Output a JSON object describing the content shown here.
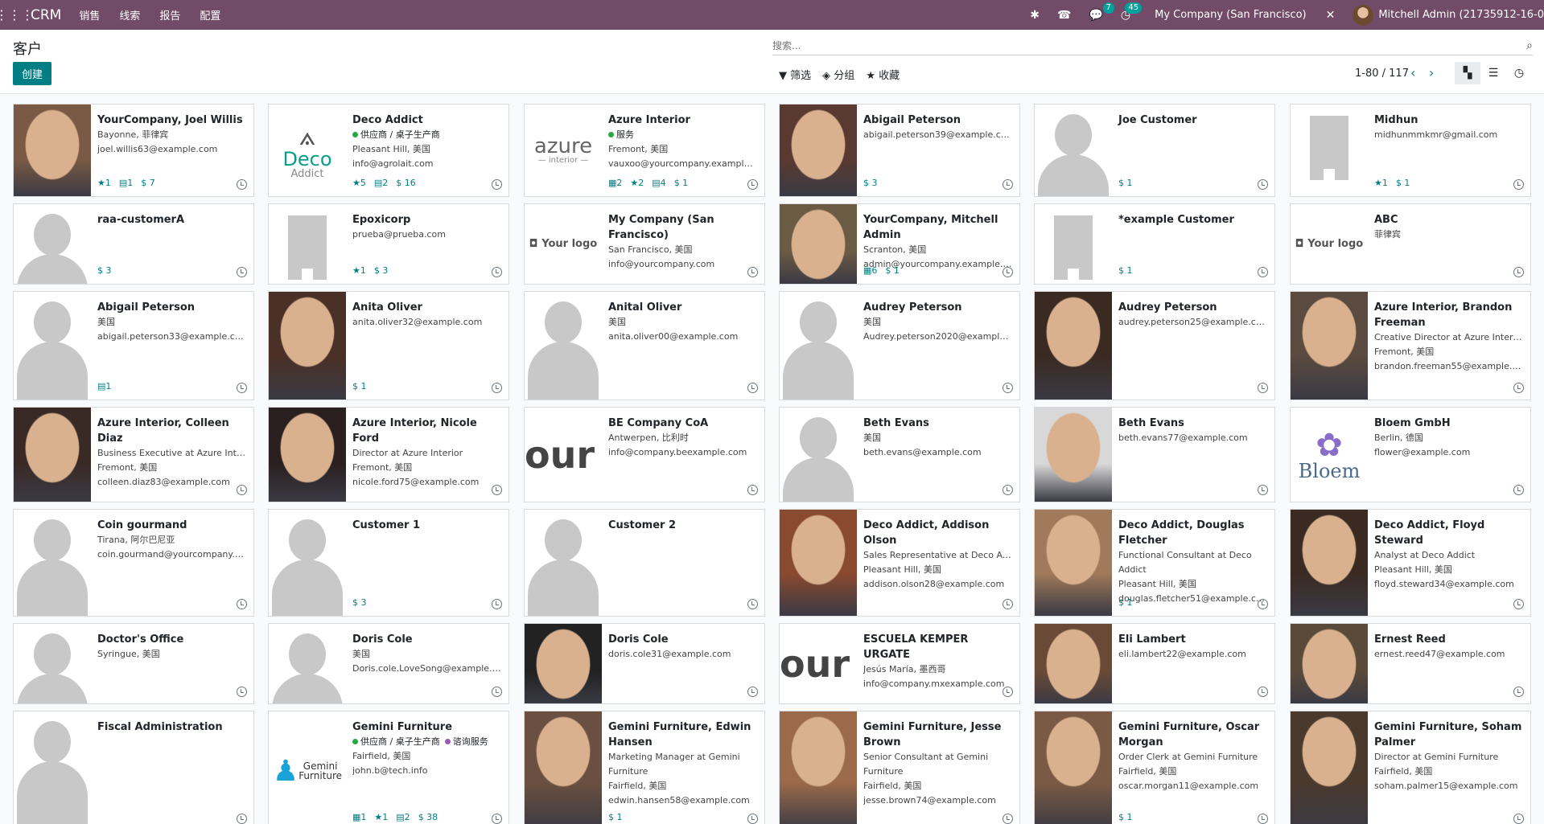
{
  "navbar": {
    "brand": "CRM",
    "menus": [
      "销售",
      "线索",
      "报告",
      "配置"
    ],
    "messages_count": "7",
    "activities_count": "45",
    "company": "My Company (San Francisco)",
    "user": "Mitchell Admin (21735912-16-0"
  },
  "control": {
    "title": "客户",
    "create": "创建",
    "search_placeholder": "搜索...",
    "filter": "筛选",
    "group": "分组",
    "favorites": "收藏",
    "pager": "1-80 / 117"
  },
  "colors": {
    "primary": "#714B67",
    "accent": "#017E84",
    "green_dot": "#28a745",
    "purple_dot": "#9b59b6"
  },
  "cards": [
    {
      "name": "YourCompany, Joel Willis",
      "lines": [
        "Bayonne, 菲律宾",
        "joel.willis63@example.com"
      ],
      "stats": [
        "★1",
        "▤1",
        "$ 7"
      ],
      "img": "photo",
      "tone": "#7a5a44"
    },
    {
      "name": "Deco Addict",
      "tags": [
        {
          "dot": "#28a745",
          "text": "供应商 / 桌子生产商"
        }
      ],
      "lines": [
        "Pleasant Hill, 美国",
        "info@agrolait.com"
      ],
      "stats": [
        "★5",
        "▤2",
        "$ 16"
      ],
      "img": "deco"
    },
    {
      "name": "Azure Interior",
      "tags": [
        {
          "dot": "#28a745",
          "text": "服务"
        }
      ],
      "lines": [
        "Fremont, 美国",
        "vauxoo@yourcompany.example.com"
      ],
      "stats": [
        "▦2",
        "★2",
        "▤4",
        "$ 1"
      ],
      "img": "azure"
    },
    {
      "name": "Abigail Peterson",
      "lines": [
        "abigail.peterson39@example.com"
      ],
      "stats": [
        "$ 3"
      ],
      "img": "photo",
      "tone": "#5a3a30"
    },
    {
      "name": "Joe Customer",
      "lines": [],
      "stats": [
        "$ 1"
      ],
      "img": "person"
    },
    {
      "name": "Midhun",
      "lines": [
        "midhunmmkmr@gmail.com"
      ],
      "stats": [
        "★1",
        "$ 1"
      ],
      "img": "building"
    },
    {
      "name": "raa-customerA",
      "lines": [],
      "stats": [
        "$ 3"
      ],
      "img": "person"
    },
    {
      "name": "Epoxicorp",
      "lines": [
        "prueba@prueba.com"
      ],
      "stats": [
        "★1",
        "$ 3"
      ],
      "img": "building"
    },
    {
      "name": "My Company (San Francisco)",
      "lines": [
        "San Francisco, 美国",
        "info@yourcompany.com"
      ],
      "stats": [],
      "img": "yourlogo"
    },
    {
      "name": "YourCompany, Mitchell Admin",
      "lines": [
        "Scranton, 美国",
        "admin@yourcompany.example.com"
      ],
      "stats": [
        "▦6",
        "$ 1"
      ],
      "img": "photo",
      "tone": "#6b5a44"
    },
    {
      "name": "*example Customer",
      "lines": [],
      "stats": [
        "$ 1"
      ],
      "img": "building"
    },
    {
      "name": "ABC",
      "lines": [
        "菲律宾"
      ],
      "stats": [],
      "img": "yourlogo"
    },
    {
      "name": "Abigail Peterson",
      "lines": [
        "美国",
        "abigail.peterson33@example.com"
      ],
      "stats": [
        "▤1"
      ],
      "img": "person"
    },
    {
      "name": "Anita Oliver",
      "lines": [
        "anita.oliver32@example.com"
      ],
      "stats": [
        "$ 1"
      ],
      "img": "photo",
      "tone": "#4a3026"
    },
    {
      "name": "Anital Oliver",
      "lines": [
        "美国",
        "anita.oliver00@example.com"
      ],
      "stats": [],
      "img": "person"
    },
    {
      "name": "Audrey Peterson",
      "lines": [
        "美国",
        "Audrey.peterson2020@example.c..."
      ],
      "stats": [],
      "img": "person"
    },
    {
      "name": "Audrey Peterson",
      "lines": [
        "audrey.peterson25@example.com"
      ],
      "stats": [],
      "img": "photo",
      "tone": "#3a2a22"
    },
    {
      "name": "Azure Interior, Brandon Freeman",
      "lines": [
        "Creative Director at Azure Interior",
        "Fremont, 美国",
        "brandon.freeman55@example.com"
      ],
      "stats": [],
      "img": "photo",
      "tone": "#5a4a40"
    },
    {
      "name": "Azure Interior, Colleen Diaz",
      "lines": [
        "Business Executive at Azure Interior",
        "Fremont, 美国",
        "colleen.diaz83@example.com"
      ],
      "stats": [],
      "img": "photo",
      "tone": "#3a2a26"
    },
    {
      "name": "Azure Interior, Nicole Ford",
      "lines": [
        "Director at Azure Interior",
        "Fremont, 美国",
        "nicole.ford75@example.com"
      ],
      "stats": [],
      "img": "photo",
      "tone": "#2a2020"
    },
    {
      "name": "BE Company CoA",
      "lines": [
        "Antwerpen, 比利时",
        "info@company.beexample.com"
      ],
      "stats": [],
      "img": "our"
    },
    {
      "name": "Beth Evans",
      "lines": [
        "美国",
        "beth.evans@example.com"
      ],
      "stats": [],
      "img": "person"
    },
    {
      "name": "Beth Evans",
      "lines": [
        "beth.evans77@example.com"
      ],
      "stats": [],
      "img": "photo",
      "tone": "#d8d8d8"
    },
    {
      "name": "Bloem GmbH",
      "lines": [
        "Berlin, 德国",
        "flower@example.com"
      ],
      "stats": [],
      "img": "bloem"
    },
    {
      "name": "Coin gourmand",
      "lines": [
        "Tirana, 阿尔巴尼亚",
        "coin.gourmand@yourcompany.exa..."
      ],
      "stats": [],
      "img": "person"
    },
    {
      "name": "Customer 1",
      "lines": [],
      "stats": [
        "$ 3"
      ],
      "img": "person"
    },
    {
      "name": "Customer 2",
      "lines": [],
      "stats": [],
      "img": "person"
    },
    {
      "name": "Deco Addict, Addison Olson",
      "lines": [
        "Sales Representative at Deco Addict",
        "Pleasant Hill, 美国",
        "addison.olson28@example.com"
      ],
      "stats": [],
      "img": "photo",
      "tone": "#8a4a30"
    },
    {
      "name": "Deco Addict, Douglas Fletcher",
      "lines": [
        "Functional Consultant at Deco",
        "Addict",
        "Pleasant Hill, 美国",
        "douglas.fletcher51@example.com"
      ],
      "stats": [
        "$ 1"
      ],
      "img": "photo",
      "tone": "#a07a5a"
    },
    {
      "name": "Deco Addict, Floyd Steward",
      "lines": [
        "Analyst at Deco Addict",
        "Pleasant Hill, 美国",
        "floyd.steward34@example.com"
      ],
      "stats": [],
      "img": "photo",
      "tone": "#3a2a22"
    },
    {
      "name": "Doctor's Office",
      "lines": [
        "Syringue, 美国"
      ],
      "stats": [],
      "img": "person"
    },
    {
      "name": "Doris Cole",
      "lines": [
        "美国",
        "Doris.cole.LoveSong@example.com"
      ],
      "stats": [],
      "img": "person"
    },
    {
      "name": "Doris Cole",
      "lines": [
        "doris.cole31@example.com"
      ],
      "stats": [],
      "img": "photo",
      "tone": "#222222"
    },
    {
      "name": "ESCUELA KEMPER URGATE",
      "lines": [
        "Jesús María, 墨西哥",
        "info@company.mxexample.com"
      ],
      "stats": [],
      "img": "our"
    },
    {
      "name": "Eli Lambert",
      "lines": [
        "eli.lambert22@example.com"
      ],
      "stats": [],
      "img": "photo",
      "tone": "#6a4a36"
    },
    {
      "name": "Ernest Reed",
      "lines": [
        "ernest.reed47@example.com"
      ],
      "stats": [],
      "img": "photo",
      "tone": "#5a4a3a"
    },
    {
      "name": "Fiscal Administration",
      "lines": [],
      "stats": [],
      "img": "person"
    },
    {
      "name": "Gemini Furniture",
      "tags": [
        {
          "dot": "#28a745",
          "text": "供应商 / 桌子生产商"
        },
        {
          "dot": "#9b59b6",
          "text": "谘询服务"
        }
      ],
      "lines": [
        "Fairfield, 美国",
        "john.b@tech.info"
      ],
      "stats": [
        "▦1",
        "★1",
        "▤2",
        "$ 38"
      ],
      "img": "gemini"
    },
    {
      "name": "Gemini Furniture, Edwin Hansen",
      "lines": [
        "Marketing Manager at Gemini",
        "Furniture",
        "Fairfield, 美国",
        "edwin.hansen58@example.com"
      ],
      "stats": [
        "$ 1"
      ],
      "img": "photo",
      "tone": "#6a5040"
    },
    {
      "name": "Gemini Furniture, Jesse Brown",
      "lines": [
        "Senior Consultant at Gemini",
        "Furniture",
        "Fairfield, 美国",
        "jesse.brown74@example.com"
      ],
      "stats": [],
      "img": "photo",
      "tone": "#9a6a4a"
    },
    {
      "name": "Gemini Furniture, Oscar Morgan",
      "lines": [
        "Order Clerk at Gemini Furniture",
        "Fairfield, 美国",
        "oscar.morgan11@example.com"
      ],
      "stats": [
        "$ 1"
      ],
      "img": "photo",
      "tone": "#7a5a44"
    },
    {
      "name": "Gemini Furniture, Soham Palmer",
      "lines": [
        "Director at Gemini Furniture",
        "Fairfield, 美国",
        "soham.palmer15@example.com"
      ],
      "stats": [],
      "img": "photo",
      "tone": "#4a3a2e"
    }
  ]
}
